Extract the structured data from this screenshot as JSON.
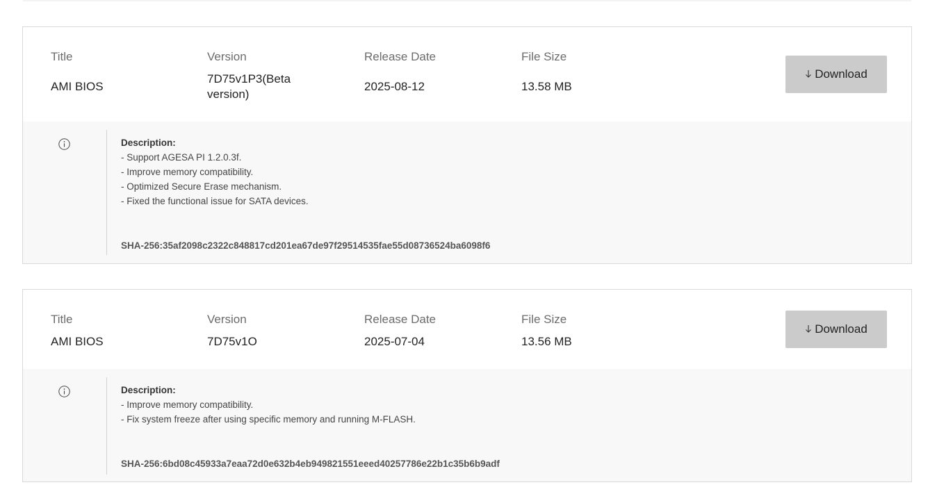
{
  "columns": {
    "title": "Title",
    "version": "Version",
    "release_date": "Release Date",
    "file_size": "File Size"
  },
  "download_label": "Download",
  "description_heading": "Description:",
  "icons": {
    "download": "down-arrow-icon",
    "info": "info-circle-icon"
  },
  "items": [
    {
      "title": "AMI BIOS",
      "version": "7D75v1P3(Beta version)",
      "release_date": "2025-08-12",
      "file_size": "13.58 MB",
      "description": [
        "- Support AGESA PI 1.2.0.3f.",
        "- Improve memory compatibility.",
        "- Optimized Secure Erase mechanism.",
        "- Fixed the functional issue for SATA devices."
      ],
      "sha": "SHA-256:35af2098c2322c848817cd201ea67de97f29514535fae55d08736524ba6098f6"
    },
    {
      "title": "AMI BIOS",
      "version": "7D75v1O",
      "release_date": "2025-07-04",
      "file_size": "13.56 MB",
      "description": [
        "- Improve memory compatibility.",
        "- Fix system freeze after using specific memory and running M-FLASH."
      ],
      "sha": "SHA-256:6bd08c45933a7eaa72d0e632b4eb949821551eeed40257786e22b1c35b6b9adf"
    }
  ]
}
